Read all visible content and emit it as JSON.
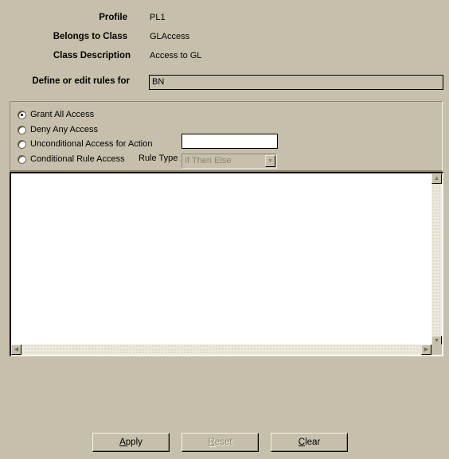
{
  "header": {
    "profile_label": "Profile",
    "profile_value": "PL1",
    "class_label": "Belongs to Class",
    "class_value": "GLAccess",
    "description_label": "Class Description",
    "description_value": "Access to GL",
    "define_label": "Define or edit rules for",
    "define_value": "BN"
  },
  "access_options": [
    {
      "label": "Grant All Access",
      "checked": true
    },
    {
      "label": "Deny Any Access",
      "checked": false
    },
    {
      "label": "Unconditional Access for Action",
      "checked": false
    },
    {
      "label": "Conditional Rule Access",
      "checked": false
    }
  ],
  "action_input_value": "",
  "rule_type": {
    "label": "Rule Type",
    "selected": "If Then Else",
    "enabled": false
  },
  "rules_text": "",
  "buttons": {
    "apply": {
      "mnemonic": "A",
      "rest": "pply",
      "enabled": true
    },
    "reset": {
      "mnemonic": "R",
      "rest": "eset",
      "enabled": false
    },
    "clear": {
      "mnemonic": "C",
      "rest": "lear",
      "enabled": true
    }
  }
}
